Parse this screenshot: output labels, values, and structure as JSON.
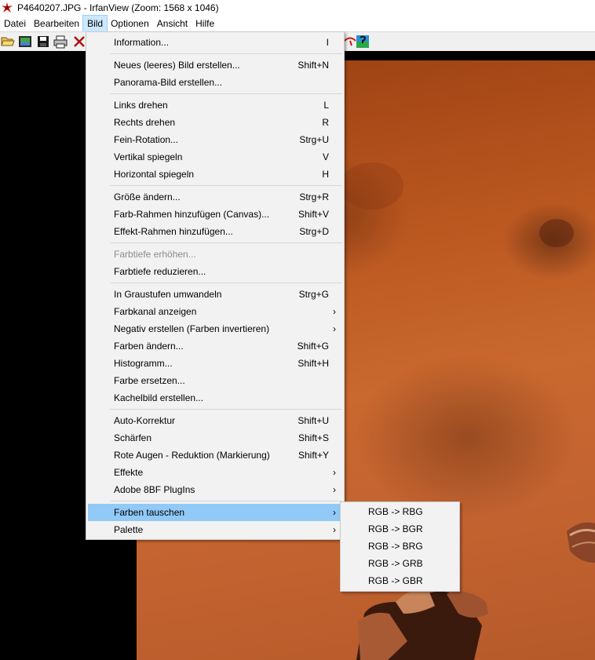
{
  "window": {
    "title": "P4640207.JPG - IrfanView (Zoom: 1568 x 1046)"
  },
  "menubar": {
    "items": [
      "Datei",
      "Bearbeiten",
      "Bild",
      "Optionen",
      "Ansicht",
      "Hilfe"
    ],
    "active": "Bild"
  },
  "colors": {
    "menu_bg": "#f2f2f2",
    "highlight": "#91c9f7",
    "active_menubar": "#cce8ff",
    "disabled_text": "#8b8b8b"
  },
  "bild_menu": {
    "items": [
      {
        "label": "Information...",
        "shortcut": "I"
      },
      {
        "label": "Neues (leeres) Bild erstellen...",
        "shortcut": "Shift+N"
      },
      {
        "label": "Panorama-Bild erstellen...",
        "shortcut": ""
      },
      {
        "label": "Links drehen",
        "shortcut": "L"
      },
      {
        "label": "Rechts drehen",
        "shortcut": "R"
      },
      {
        "label": "Fein-Rotation...",
        "shortcut": "Strg+U"
      },
      {
        "label": "Vertikal spiegeln",
        "shortcut": "V"
      },
      {
        "label": "Horizontal spiegeln",
        "shortcut": "H"
      },
      {
        "label": "Größe ändern...",
        "shortcut": "Strg+R"
      },
      {
        "label": "Farb-Rahmen hinzufügen (Canvas)...",
        "shortcut": "Shift+V"
      },
      {
        "label": "Effekt-Rahmen hinzufügen...",
        "shortcut": "Strg+D"
      },
      {
        "label": "Farbtiefe erhöhen...",
        "shortcut": "",
        "disabled": true
      },
      {
        "label": "Farbtiefe reduzieren...",
        "shortcut": ""
      },
      {
        "label": "In Graustufen umwandeln",
        "shortcut": "Strg+G"
      },
      {
        "label": "Farbkanal anzeigen",
        "shortcut": "",
        "submenu": true
      },
      {
        "label": "Negativ erstellen (Farben invertieren)",
        "shortcut": "",
        "submenu": true
      },
      {
        "label": "Farben ändern...",
        "shortcut": "Shift+G"
      },
      {
        "label": "Histogramm...",
        "shortcut": "Shift+H"
      },
      {
        "label": "Farbe ersetzen...",
        "shortcut": ""
      },
      {
        "label": "Kachelbild erstellen...",
        "shortcut": ""
      },
      {
        "label": "Auto-Korrektur",
        "shortcut": "Shift+U"
      },
      {
        "label": "Schärfen",
        "shortcut": "Shift+S"
      },
      {
        "label": "Rote Augen - Reduktion (Markierung)",
        "shortcut": "Shift+Y"
      },
      {
        "label": "Effekte",
        "shortcut": "",
        "submenu": true
      },
      {
        "label": "Adobe 8BF PlugIns",
        "shortcut": "",
        "submenu": true
      },
      {
        "label": "Farben tauschen",
        "shortcut": "",
        "submenu": true,
        "highlighted": true
      },
      {
        "label": "Palette",
        "shortcut": "",
        "submenu": true
      }
    ],
    "arrow_glyph": "›"
  },
  "submenu_farben_tauschen": {
    "items": [
      "RGB -> RBG",
      "RGB -> BGR",
      "RGB -> BRG",
      "RGB -> GRB",
      "RGB -> GBR"
    ]
  },
  "toolbar": {
    "buttons": [
      "open-folder-icon",
      "slideshow-icon",
      "save-icon",
      "print-icon",
      "delete-icon",
      "red-eye-icon",
      "paint-icon"
    ]
  }
}
